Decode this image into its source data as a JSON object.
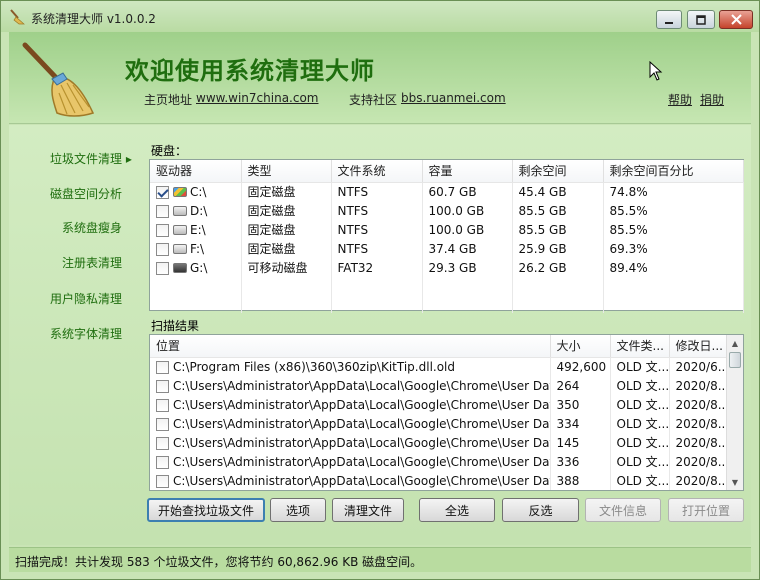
{
  "window": {
    "title": "系统清理大师 v1.0.0.2"
  },
  "header": {
    "app_title": "欢迎使用系统清理大师",
    "homepage_label": "主页地址",
    "homepage_url": "www.win7china.com",
    "support_label": "支持社区",
    "support_url": "bbs.ruanmei.com",
    "help": "帮助",
    "donate": "捐助"
  },
  "nav": {
    "items": [
      {
        "label": "垃圾文件清理",
        "arrow": "▸"
      },
      {
        "label": "磁盘空间分析"
      },
      {
        "label": "系统盘瘦身"
      },
      {
        "label": "注册表清理"
      },
      {
        "label": "用户隐私清理"
      },
      {
        "label": "系统字体清理"
      }
    ]
  },
  "disks": {
    "section_label": "硬盘：",
    "columns": [
      "驱动器",
      "类型",
      "文件系统",
      "容量",
      "剩余空间",
      "剩余空间百分比"
    ],
    "rows": [
      {
        "checked": true,
        "icon": "system-drive-icon",
        "drive": "C:\\",
        "type": "固定磁盘",
        "fs": "NTFS",
        "capacity": "60.7 GB",
        "free": "45.4 GB",
        "pct": "74.8%"
      },
      {
        "checked": false,
        "icon": "hard-drive-icon",
        "drive": "D:\\",
        "type": "固定磁盘",
        "fs": "NTFS",
        "capacity": "100.0 GB",
        "free": "85.5 GB",
        "pct": "85.5%"
      },
      {
        "checked": false,
        "icon": "hard-drive-icon",
        "drive": "E:\\",
        "type": "固定磁盘",
        "fs": "NTFS",
        "capacity": "100.0 GB",
        "free": "85.5 GB",
        "pct": "85.5%"
      },
      {
        "checked": false,
        "icon": "hard-drive-icon",
        "drive": "F:\\",
        "type": "固定磁盘",
        "fs": "NTFS",
        "capacity": "37.4 GB",
        "free": "25.9 GB",
        "pct": "69.3%"
      },
      {
        "checked": false,
        "icon": "usb-drive-icon",
        "drive": "G:\\",
        "type": "可移动磁盘",
        "fs": "FAT32",
        "capacity": "29.3 GB",
        "free": "26.2 GB",
        "pct": "89.4%"
      }
    ]
  },
  "results": {
    "section_label": "扫描结果",
    "columns": [
      "位置",
      "大小",
      "文件类...",
      "修改日..."
    ],
    "rows": [
      {
        "path": "C:\\Program Files (x86)\\360\\360zip\\KitTip.dll.old",
        "size": "492,600",
        "type": "OLD 文...",
        "date": "2020/6..."
      },
      {
        "path": "C:\\Users\\Administrator\\AppData\\Local\\Google\\Chrome\\User Data\\D...",
        "size": "264",
        "type": "OLD 文...",
        "date": "2020/8..."
      },
      {
        "path": "C:\\Users\\Administrator\\AppData\\Local\\Google\\Chrome\\User Data\\D...",
        "size": "350",
        "type": "OLD 文...",
        "date": "2020/8..."
      },
      {
        "path": "C:\\Users\\Administrator\\AppData\\Local\\Google\\Chrome\\User Data\\D...",
        "size": "334",
        "type": "OLD 文...",
        "date": "2020/8..."
      },
      {
        "path": "C:\\Users\\Administrator\\AppData\\Local\\Google\\Chrome\\User Data\\D...",
        "size": "145",
        "type": "OLD 文...",
        "date": "2020/8..."
      },
      {
        "path": "C:\\Users\\Administrator\\AppData\\Local\\Google\\Chrome\\User Data\\D...",
        "size": "336",
        "type": "OLD 文...",
        "date": "2020/8..."
      },
      {
        "path": "C:\\Users\\Administrator\\AppData\\Local\\Google\\Chrome\\User Data\\D...",
        "size": "388",
        "type": "OLD 文...",
        "date": "2020/8..."
      }
    ]
  },
  "buttons": {
    "start_scan": "开始查找垃圾文件",
    "options": "选项",
    "clean": "清理文件",
    "select_all": "全选",
    "invert": "反选",
    "file_info": "文件信息",
    "open_location": "打开位置"
  },
  "status": {
    "text": "扫描完成！共计发现 583 个垃圾文件，您将节约 60,862.96 KB 磁盘空间。"
  },
  "colors": {
    "accent": "#1f6e0f",
    "background": "#c9e4b5",
    "header": "#9fd08a"
  }
}
